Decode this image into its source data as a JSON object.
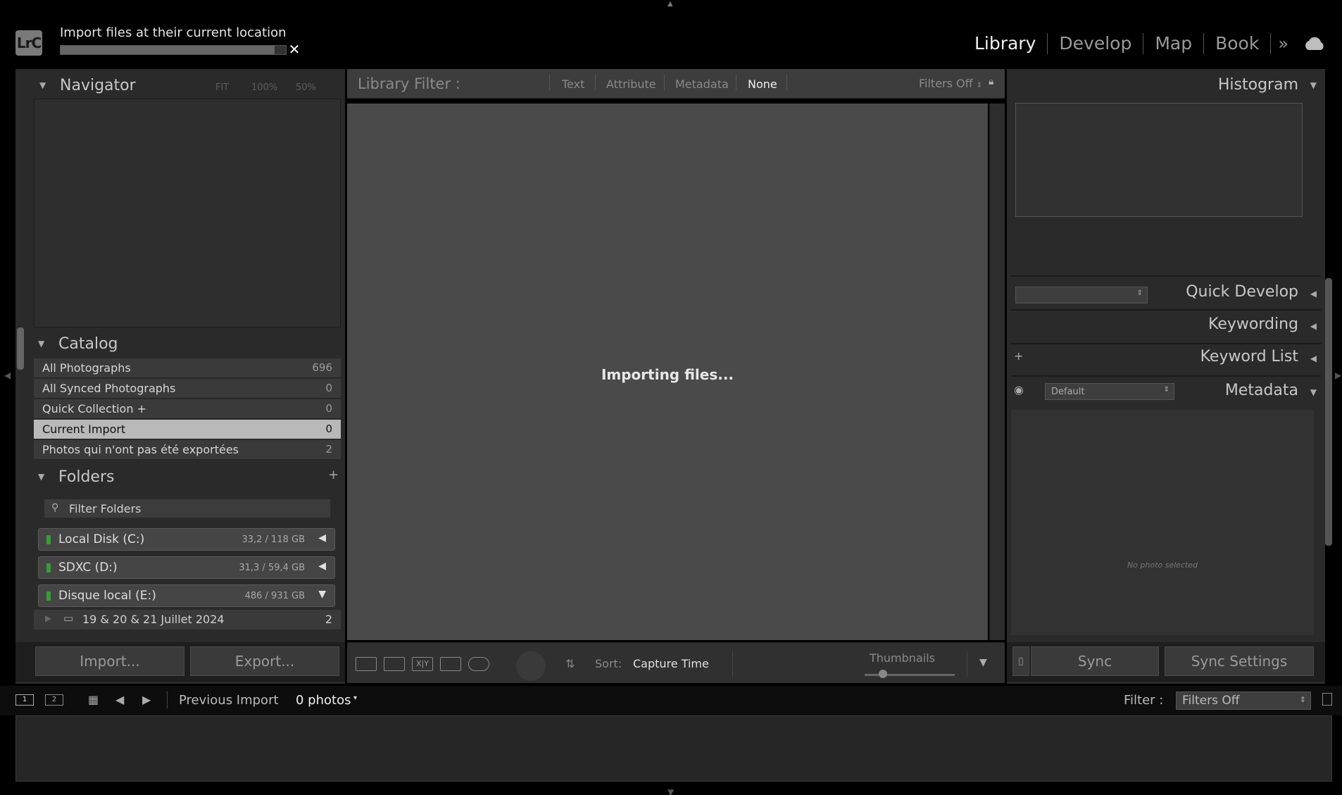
{
  "topbar": {
    "logo": "LrC",
    "import_message": "Import files at their current location",
    "import_progress": 0.95,
    "modules": [
      "Library",
      "Develop",
      "Map",
      "Book"
    ],
    "active_module": "Library"
  },
  "left": {
    "navigator": {
      "title": "Navigator",
      "zoom": [
        "FIT",
        "100%",
        "50%"
      ]
    },
    "catalog": {
      "title": "Catalog",
      "items": [
        {
          "label": "All Photographs",
          "count": "696"
        },
        {
          "label": "All Synced Photographs",
          "count": "0"
        },
        {
          "label": "Quick Collection +",
          "count": "0"
        },
        {
          "label": "Current Import",
          "count": "0"
        },
        {
          "label": "Photos qui n'ont pas été exportées",
          "count": "2"
        }
      ],
      "selected": 3
    },
    "folders": {
      "title": "Folders",
      "filter_placeholder": "Filter Folders",
      "drives": [
        {
          "name": "Local Disk (C:)",
          "size": "33,2 / 118 GB"
        },
        {
          "name": "SDXC (D:)",
          "size": "31,3 / 59,4 GB"
        },
        {
          "name": "Disque local (E:)",
          "size": "486 / 931 GB"
        }
      ],
      "folder": {
        "name": "19 & 20 & 21 Juillet 2024",
        "count": "2"
      }
    },
    "import_label": "Import...",
    "export_label": "Export..."
  },
  "center": {
    "filter_label": "Library Filter :",
    "filter_tabs": [
      "Text",
      "Attribute",
      "Metadata",
      "None"
    ],
    "filters_off": "Filters Off",
    "status": "Importing files...",
    "sort_label": "Sort:",
    "sort_value": "Capture Time",
    "thumbnails_label": "Thumbnails"
  },
  "right": {
    "histogram": "Histogram",
    "quick_develop": "Quick Develop",
    "keywording": "Keywording",
    "keyword_list": "Keyword List",
    "keyword_plus": "+",
    "metadata": "Metadata",
    "metadata_preset": "Default",
    "no_photo": "No photo selected",
    "sync_label": "Sync",
    "sync_settings_label": "Sync Settings"
  },
  "filmstrip": {
    "view1": "1",
    "view2": "2",
    "source": "Previous Import",
    "photos": "0 photos",
    "filter_label": "Filter :",
    "filter_value": "Filters Off"
  }
}
